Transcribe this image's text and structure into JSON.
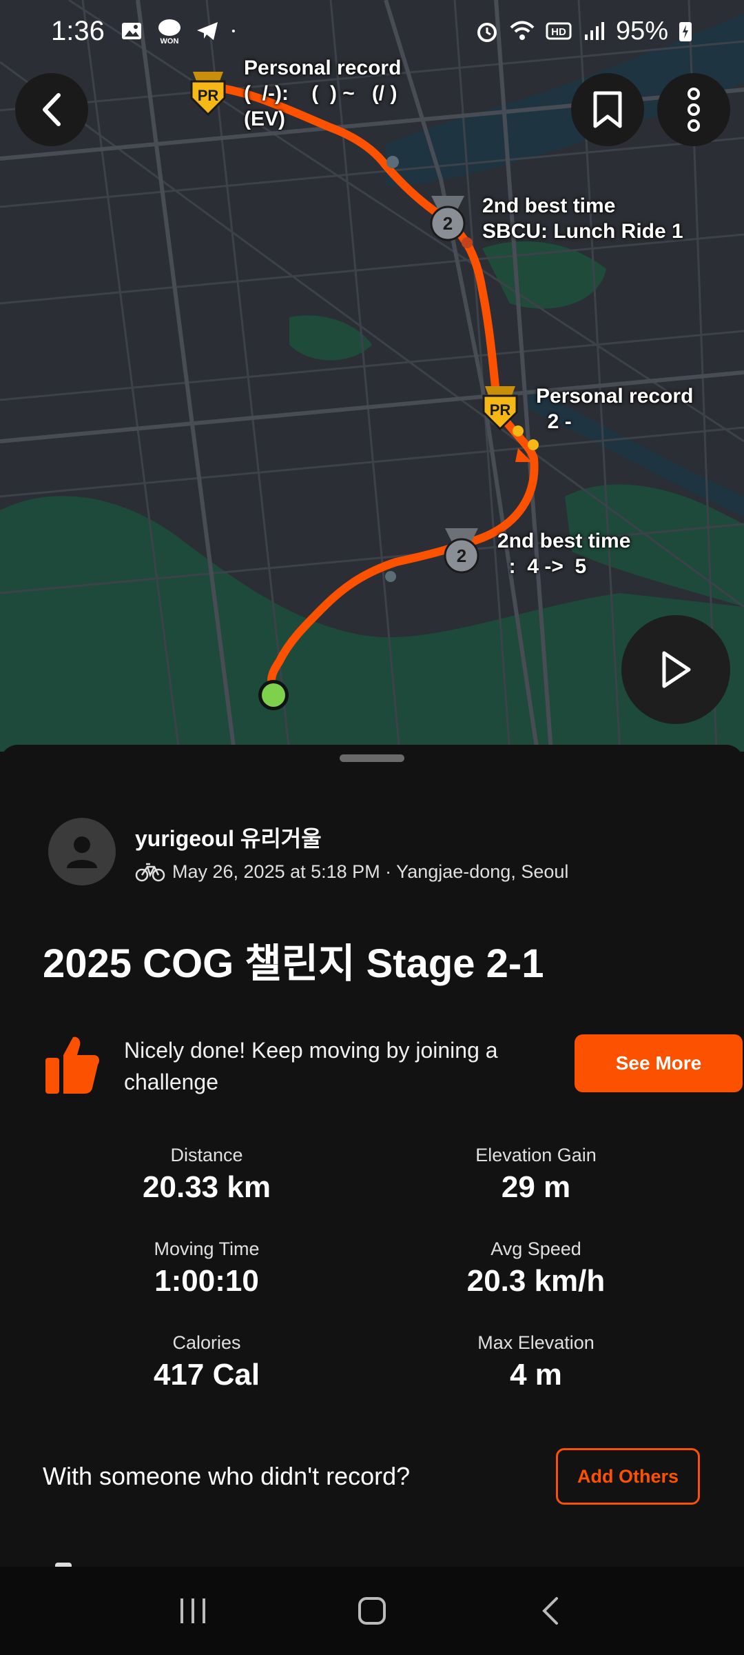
{
  "status_bar": {
    "time": "1:36",
    "battery": "95%",
    "left_icons": [
      "gallery-icon",
      "won-chat-icon",
      "telegram-icon",
      "dot-icon"
    ],
    "right_icons": [
      "alarm-icon",
      "wifi-icon",
      "hd-icon",
      "signal-icon",
      "battery-icon"
    ],
    "won_badge": "WON",
    "hd_badge": "HD"
  },
  "map": {
    "labels": [
      {
        "id": "pr1",
        "text": "Personal record\n(  /-):    (  ) ~   (/ )\n(EV)"
      },
      {
        "id": "best1",
        "text": "2nd best time\nSBCU: Lunch Ride 1"
      },
      {
        "id": "pr2",
        "text": "Personal record\n  2 -"
      },
      {
        "id": "best2",
        "text": "2nd best time\n  :  4 ->  5"
      }
    ],
    "badges": {
      "pr": "PR",
      "second": "2"
    },
    "colors": {
      "route": "#fc5200",
      "start": "#7ed14a",
      "pr_badge": "#f5b816",
      "silver_badge": "#8a8f96"
    }
  },
  "activity": {
    "athlete_name": "yurigeoul 유리거울",
    "meta": "May 26, 2025 at 5:18 PM · Yangjae-dong, Seoul",
    "title": "2025 COG 챌린지 Stage 2-1"
  },
  "promo": {
    "text": "Nicely done! Keep moving by joining a challenge",
    "button": "See More"
  },
  "stats": [
    {
      "label": "Distance",
      "value": "20.33 km"
    },
    {
      "label": "Elevation Gain",
      "value": "29 m"
    },
    {
      "label": "Moving Time",
      "value": "1:00:10"
    },
    {
      "label": "Avg Speed",
      "value": "20.3 km/h"
    },
    {
      "label": "Calories",
      "value": "417 Cal"
    },
    {
      "label": "Max Elevation",
      "value": "4 m"
    }
  ],
  "others": {
    "prompt": "With someone who didn't record?",
    "button": "Add Others"
  },
  "colors": {
    "accent": "#fc5200",
    "sheet_bg": "#121212"
  }
}
